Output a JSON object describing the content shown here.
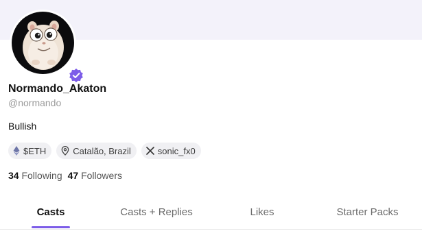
{
  "profile": {
    "display_name": "Normando_Akaton",
    "username": "@normando",
    "bio": "Bullish",
    "verified": true,
    "avatar_icon": "hamster-avatar"
  },
  "chips": [
    {
      "icon": "ethereum-icon",
      "label": "$ETH"
    },
    {
      "icon": "location-pin-icon",
      "label": "Catalão, Brazil"
    },
    {
      "icon": "x-logo-icon",
      "label": "sonic_fx0"
    }
  ],
  "stats": {
    "following_count": "34",
    "following_label": "Following",
    "followers_count": "47",
    "followers_label": "Followers"
  },
  "tabs": [
    {
      "label": "Casts",
      "active": true
    },
    {
      "label": "Casts + Replies",
      "active": false
    },
    {
      "label": "Likes",
      "active": false
    },
    {
      "label": "Starter Packs",
      "active": false
    }
  ],
  "colors": {
    "accent": "#7c5ce8",
    "banner": "#f3f2fa",
    "chip_bg": "#f0f0f3",
    "muted_text": "#9a9a9a"
  }
}
